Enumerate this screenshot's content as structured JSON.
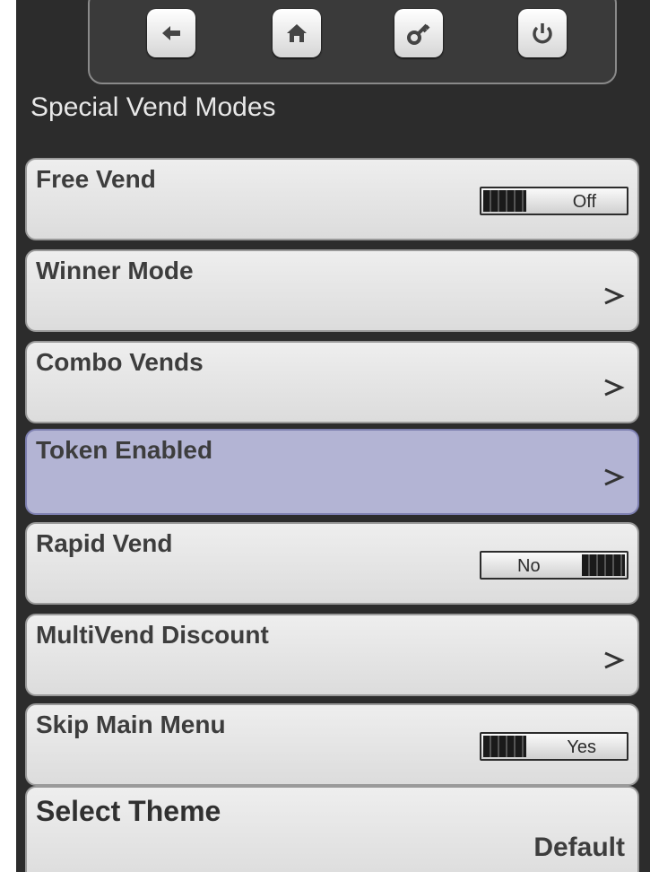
{
  "header": {
    "title": "Special Vend Modes",
    "nav_buttons": [
      {
        "icon": "back-arrow-icon"
      },
      {
        "icon": "home-icon"
      },
      {
        "icon": "key-icon"
      },
      {
        "icon": "power-icon"
      }
    ]
  },
  "rows": [
    {
      "label": "Free Vend",
      "type": "toggle",
      "value": "Off"
    },
    {
      "label": "Winner Mode",
      "type": "submenu"
    },
    {
      "label": "Combo Vends",
      "type": "submenu"
    },
    {
      "label": "Token Enabled",
      "type": "submenu",
      "selected": true
    },
    {
      "label": "Rapid Vend",
      "type": "toggle",
      "value": "No"
    },
    {
      "label": "MultiVend Discount",
      "type": "submenu"
    },
    {
      "label": "Skip Main Menu",
      "type": "toggle",
      "value": "Yes"
    },
    {
      "label": "Select Theme",
      "type": "value",
      "value": "Default"
    }
  ],
  "colors": {
    "background": "#2c2c2c",
    "row": "#e6e6e6",
    "selected_row": "#b3b4d4"
  }
}
